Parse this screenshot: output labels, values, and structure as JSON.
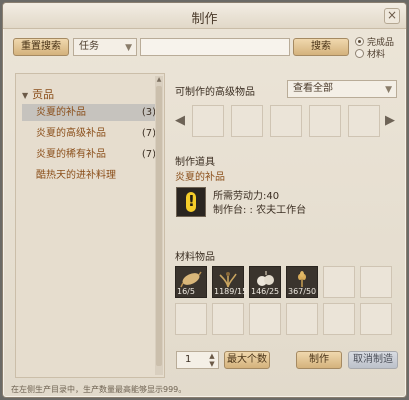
{
  "window": {
    "title": "制作",
    "close_glyph": "×"
  },
  "search": {
    "reset_label": "重置搜索",
    "type_value": "任务",
    "input_value": "",
    "search_label": "搜索",
    "radio_options": [
      {
        "label": "完成品",
        "selected": true
      },
      {
        "label": "材料",
        "selected": false
      }
    ]
  },
  "categories": {
    "header": "贡品",
    "items": [
      {
        "label": "炎夏的补品",
        "count": "(3)",
        "selected": true
      },
      {
        "label": "炎夏的高级补品",
        "count": "(7)",
        "selected": false
      },
      {
        "label": "炎夏的稀有补品",
        "count": "(7)",
        "selected": false
      },
      {
        "label": "酷热天的进补料理",
        "count": "",
        "selected": false
      }
    ]
  },
  "advanced": {
    "title": "可制作的高级物品",
    "filter_value": "查看全部",
    "slot_count": 5
  },
  "tool": {
    "section_title": "制作道具",
    "item_name": "炎夏的补品",
    "labor_cost": "所需劳动力:40",
    "workbench": "制作台: : 农夫工作台",
    "icon": "warning-icon"
  },
  "materials": {
    "title": "材料物品",
    "items": [
      {
        "name": "root-icon",
        "count": "16/5"
      },
      {
        "name": "herb-icon",
        "count": "1189/15"
      },
      {
        "name": "garlic-icon",
        "count": "146/25"
      },
      {
        "name": "wheat-icon",
        "count": "367/50"
      }
    ],
    "empty_slots": 8
  },
  "controls": {
    "quantity": "1",
    "max_label": "最大个数",
    "craft_label": "制作",
    "cancel_label": "取消制造"
  },
  "footer_text": "在左侧生产目录中，生产数量最高能够显示999。",
  "colors": {
    "accent_brown": "#d4b27c",
    "category_text": "#8b4f1a",
    "panel_bg": "#e6ddce"
  }
}
